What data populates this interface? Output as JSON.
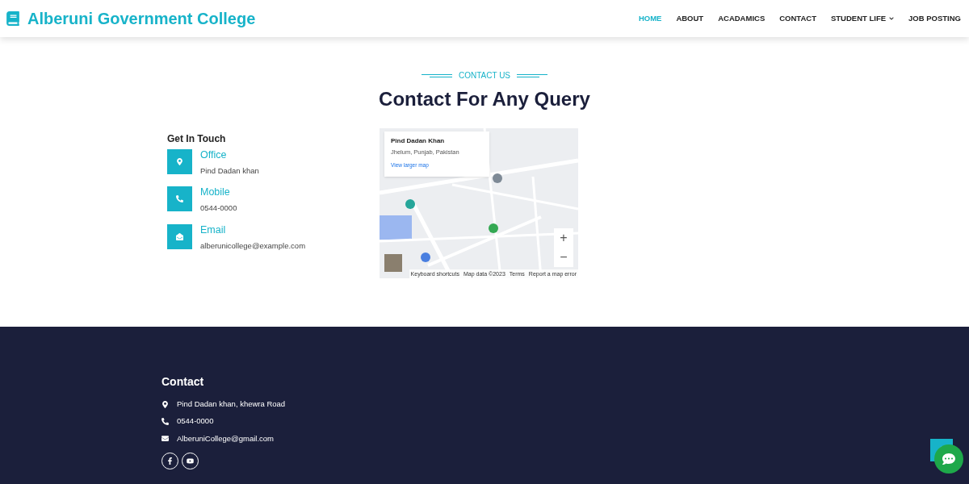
{
  "brand": {
    "name": "Alberuni Government College"
  },
  "nav": [
    {
      "label": "HOME",
      "selected": true,
      "has_dropdown": false
    },
    {
      "label": "ABOUT",
      "selected": false,
      "has_dropdown": false
    },
    {
      "label": "ACADAMICS",
      "selected": false,
      "has_dropdown": false
    },
    {
      "label": "CONTACT",
      "selected": false,
      "has_dropdown": false
    },
    {
      "label": "STUDENT LIFE",
      "selected": false,
      "has_dropdown": true
    },
    {
      "label": "JOB POSTING",
      "selected": false,
      "has_dropdown": false
    }
  ],
  "section": {
    "eyebrow": "CONTACT US",
    "title": "Contact For Any Query"
  },
  "get_in_touch": {
    "heading": "Get In Touch",
    "items": [
      {
        "kind": "location",
        "title": "Office",
        "value": "Pind Dadan khan"
      },
      {
        "kind": "phone",
        "title": "Mobile",
        "value": "0544-0000"
      },
      {
        "kind": "email",
        "title": "Email",
        "value": "alberunicollege@example.com"
      }
    ]
  },
  "map": {
    "card": {
      "title": "Pind Dadan Khan",
      "subtitle": "Jhelum, Punjab, Pakistan",
      "link": "View larger map"
    },
    "zoom_in": "+",
    "zoom_out": "−",
    "attribution": [
      "Keyboard shortcuts",
      "Map data ©2023",
      "Terms",
      "Report a map error"
    ]
  },
  "footer": {
    "heading": "Contact",
    "items": [
      {
        "kind": "location",
        "text": "Pind Dadan khan, khewra Road"
      },
      {
        "kind": "phone",
        "text": "0544-0000"
      },
      {
        "kind": "email",
        "text": "AlberuniCollege@gmail.com"
      }
    ],
    "social": [
      {
        "kind": "facebook"
      },
      {
        "kind": "youtube"
      }
    ]
  }
}
